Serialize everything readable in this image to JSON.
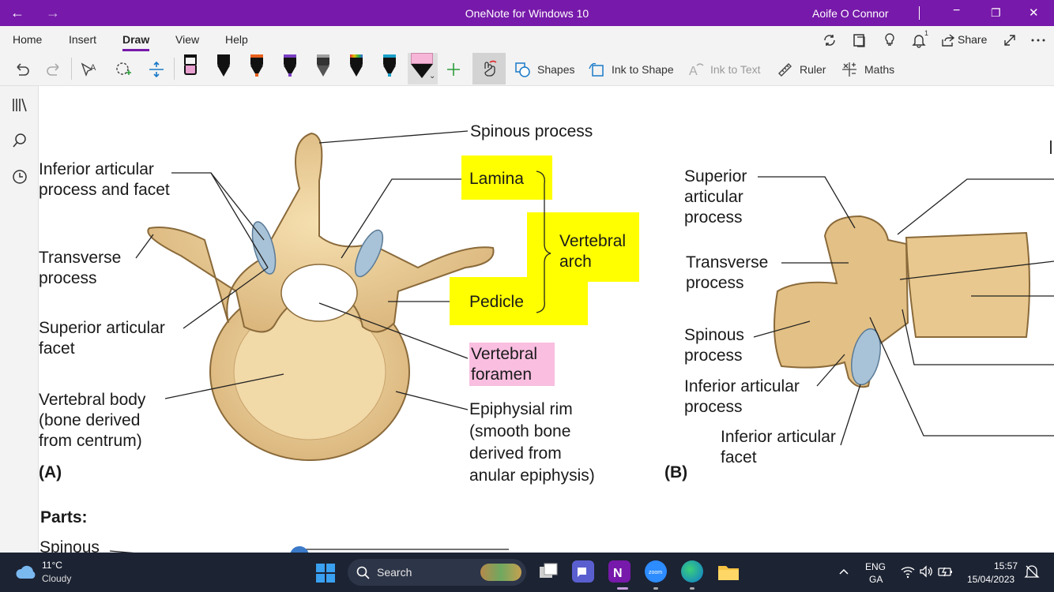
{
  "window": {
    "title": "OneNote for Windows 10",
    "user": "Aoife O Connor",
    "back_glyph": "←",
    "forward_glyph": "→",
    "minimize_glyph": "−",
    "restore_glyph": "❐",
    "close_glyph": "✕"
  },
  "menu": {
    "items": [
      "Home",
      "Insert",
      "Draw",
      "View",
      "Help"
    ],
    "active": "Draw",
    "share_label": "Share",
    "notification_count": "1",
    "accent_color": "#7719aa"
  },
  "toolbar": {
    "pens": [
      {
        "name": "pen-pink-highlighter",
        "band": "#e8a0d0"
      },
      {
        "name": "pen-black",
        "band": "#111111"
      },
      {
        "name": "pen-orange",
        "band": "#e8601c"
      },
      {
        "name": "pen-purple",
        "band": "#7a3fc2"
      },
      {
        "name": "pen-galaxy",
        "band": "#a0a0a0"
      },
      {
        "name": "pen-rainbow",
        "band": "#d4a000"
      },
      {
        "name": "pen-teal",
        "band": "#1aa0c8"
      }
    ],
    "shapes_label": "Shapes",
    "ink_to_shape_label": "Ink to Shape",
    "ink_to_text_label": "Ink to Text",
    "ruler_label": "Ruler",
    "maths_label": "Maths"
  },
  "figure_a": {
    "labels": {
      "spinous_process": "Spinous process",
      "inferior_articular_1": "Inferior articular",
      "inferior_articular_2": "process and facet",
      "lamina": "Lamina",
      "vertebral_arch_1": "Vertebral",
      "vertebral_arch_2": "arch",
      "transverse_1": "Transverse",
      "transverse_2": "process",
      "pedicle": "Pedicle",
      "superior_facet_1": "Superior articular",
      "superior_facet_2": "facet",
      "foramen_1": "Vertebral",
      "foramen_2": "foramen",
      "body_1": "Vertebral body",
      "body_2": "(bone  derived",
      "body_3": "from centrum)",
      "rim_1": "Epiphysial rim",
      "rim_2": "(smooth bone",
      "rim_3": "derived from",
      "rim_4": "anular epiphysis)"
    },
    "letter": "(A)"
  },
  "figure_b": {
    "labels": {
      "superior_1": "Superior",
      "superior_2": "articular",
      "superior_3": "process",
      "transverse_1": "Transverse",
      "transverse_2": "process",
      "spinous_1": "Spinous",
      "spinous_2": "process",
      "inf_proc_1": "Inferior articular",
      "inf_proc_2": "process",
      "inf_facet_1": "Inferior articular",
      "inf_facet_2": "facet"
    },
    "letter": "(B)"
  },
  "notes": {
    "parts_heading": "Parts:",
    "partial_line": "Spinous"
  },
  "taskbar": {
    "temperature": "11°C",
    "weather": "Cloudy",
    "search_label": "Search",
    "lang_1": "ENG",
    "lang_2": "GA",
    "time": "15:57",
    "date": "15/04/2023"
  }
}
